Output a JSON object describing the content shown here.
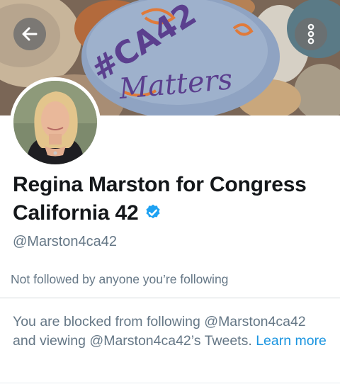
{
  "header": {
    "back_icon": "arrow-left-icon",
    "more_icon": "more-vertical-icon",
    "banner_text_line1": "#CA42",
    "banner_text_line2": "Matters"
  },
  "profile": {
    "name": "Regina Marston for Congress California 42",
    "verified": true,
    "handle": "@Marston4ca42",
    "followed_by": "Not followed by anyone you’re following"
  },
  "blocked_notice": {
    "text": "You are blocked from following @Marston4ca42 and viewing @Marston4ca42’s Tweets.",
    "link_text": "Learn more"
  },
  "colors": {
    "text_primary": "#14171a",
    "text_secondary": "#657786",
    "link": "#1b95e0",
    "verified": "#1da1f2"
  }
}
